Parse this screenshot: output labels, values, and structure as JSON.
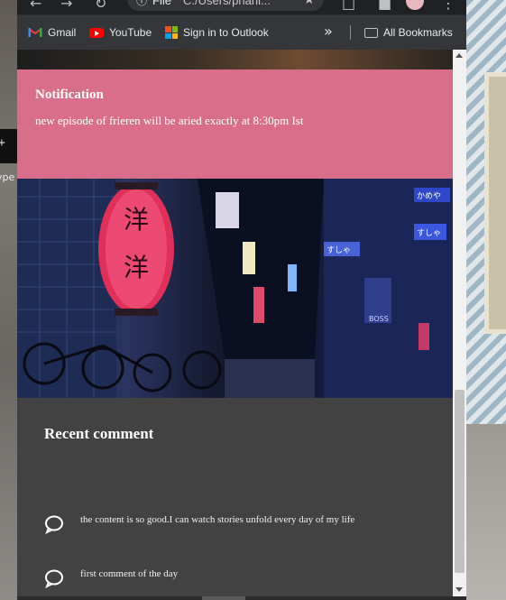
{
  "desktop": {
    "left_text": "ype"
  },
  "browser": {
    "address_scheme": "File",
    "address_text": "C:/Users/phani...",
    "bookmarks": [
      {
        "label": "Gmail",
        "icon": "gmail-icon"
      },
      {
        "label": "YouTube",
        "icon": "youtube-icon"
      },
      {
        "label": "Sign in to Outlook",
        "icon": "microsoft-icon"
      }
    ],
    "overflow_label": "»",
    "all_bookmarks_label": "All Bookmarks"
  },
  "notification": {
    "title": "Notification",
    "message": "new episode of frieren will be aried exactly at 8:30pm Ist",
    "background": "#d96e8a"
  },
  "photo": {
    "lantern_text_1": "洋",
    "lantern_text_2": "洋",
    "signs": [
      "かめや",
      "すしゃ",
      "すしゃ",
      "BOSS"
    ]
  },
  "comments": {
    "heading": "Recent comment",
    "items": [
      {
        "text": "the content is so good.I can watch stories unfold every day of my life"
      },
      {
        "text": "first comment of the day"
      }
    ]
  }
}
